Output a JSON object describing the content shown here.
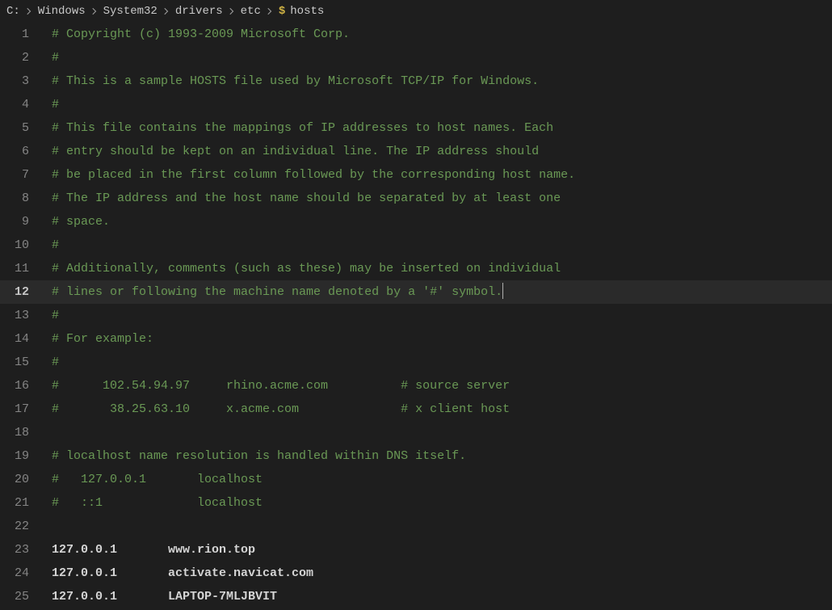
{
  "breadcrumb": {
    "segments": [
      "C:",
      "Windows",
      "System32",
      "drivers",
      "etc"
    ],
    "file_icon": "$",
    "file": "hosts"
  },
  "editor": {
    "current_line_index": 11,
    "lines": [
      {
        "n": 1,
        "kind": "comment",
        "text": "# Copyright (c) 1993-2009 Microsoft Corp."
      },
      {
        "n": 2,
        "kind": "comment",
        "text": "#"
      },
      {
        "n": 3,
        "kind": "comment",
        "text": "# This is a sample HOSTS file used by Microsoft TCP/IP for Windows."
      },
      {
        "n": 4,
        "kind": "comment",
        "text": "#"
      },
      {
        "n": 5,
        "kind": "comment",
        "text": "# This file contains the mappings of IP addresses to host names. Each"
      },
      {
        "n": 6,
        "kind": "comment",
        "text": "# entry should be kept on an individual line. The IP address should"
      },
      {
        "n": 7,
        "kind": "comment",
        "text": "# be placed in the first column followed by the corresponding host name."
      },
      {
        "n": 8,
        "kind": "comment",
        "text": "# The IP address and the host name should be separated by at least one"
      },
      {
        "n": 9,
        "kind": "comment",
        "text": "# space."
      },
      {
        "n": 10,
        "kind": "comment",
        "text": "#"
      },
      {
        "n": 11,
        "kind": "comment",
        "text": "# Additionally, comments (such as these) may be inserted on individual"
      },
      {
        "n": 12,
        "kind": "comment",
        "text": "# lines or following the machine name denoted by a '#' symbol."
      },
      {
        "n": 13,
        "kind": "comment",
        "text": "#"
      },
      {
        "n": 14,
        "kind": "comment",
        "text": "# For example:"
      },
      {
        "n": 15,
        "kind": "comment",
        "text": "#"
      },
      {
        "n": 16,
        "kind": "comment",
        "text": "#      102.54.94.97     rhino.acme.com          # source server"
      },
      {
        "n": 17,
        "kind": "comment",
        "text": "#       38.25.63.10     x.acme.com              # x client host"
      },
      {
        "n": 18,
        "kind": "blank",
        "text": ""
      },
      {
        "n": 19,
        "kind": "comment",
        "text": "# localhost name resolution is handled within DNS itself."
      },
      {
        "n": 20,
        "kind": "comment",
        "text": "#   127.0.0.1       localhost"
      },
      {
        "n": 21,
        "kind": "comment",
        "text": "#   ::1             localhost"
      },
      {
        "n": 22,
        "kind": "blank",
        "text": ""
      },
      {
        "n": 23,
        "kind": "plain",
        "text": "127.0.0.1       www.rion.top"
      },
      {
        "n": 24,
        "kind": "plain",
        "text": "127.0.0.1       activate.navicat.com"
      },
      {
        "n": 25,
        "kind": "plain",
        "text": "127.0.0.1       LAPTOP-7MLJBVIT"
      }
    ]
  }
}
